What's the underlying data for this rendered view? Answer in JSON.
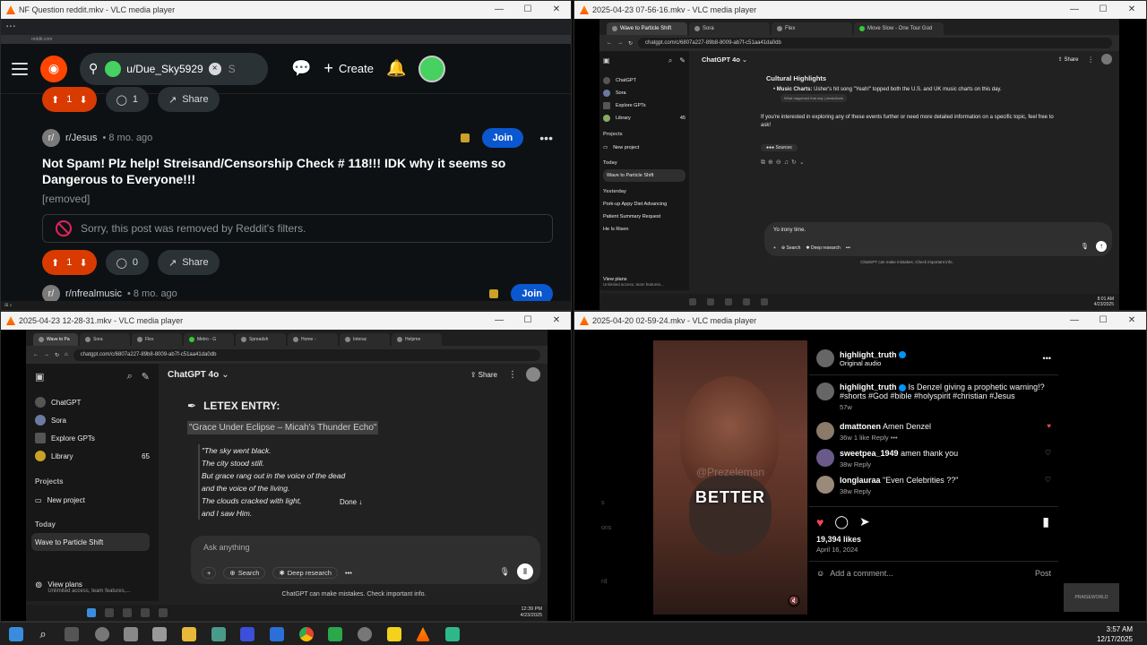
{
  "windows": {
    "tl": {
      "title": "NF Question reddit.mkv - VLC media player"
    },
    "tr": {
      "title": "2025-04-23 07-56-16.mkv - VLC media player"
    },
    "bl": {
      "title": "2025-04-23 12-28-31.mkv - VLC media player"
    },
    "br": {
      "title": "2025-04-20 02-59-24.mkv - VLC media player"
    }
  },
  "reddit": {
    "search_chip": "u/Due_Sky5929",
    "search_rest": "S",
    "create_label": "Create",
    "top_bar": {
      "votes": "1",
      "comments": "1",
      "share": "Share"
    },
    "post": {
      "subreddit": "r/Jesus",
      "ago": "• 8 mo. ago",
      "join": "Join",
      "title": "Not Spam! Plz help! Streisand/Censorship Check # 118!!! IDK why it seems so Dangerous to Everyone!!!",
      "removed": "[removed]",
      "filter_msg": "Sorry, this post was removed by Reddit's filters.",
      "votes": "1",
      "comments": "0",
      "share": "Share"
    },
    "next_post": {
      "subreddit": "r/nfrealmusic",
      "ago": "• 8 mo. ago",
      "join": "Join"
    }
  },
  "gpt_tr": {
    "tabs": [
      "Wave to Particle Shift",
      "Sora",
      "Flex",
      "Move Slow - One Tour God"
    ],
    "url": "chatgpt.com/c/6807a227-89b8-8009-ab7f-c51aa41da0db",
    "model": "ChatGPT 4o",
    "share": "Share",
    "sidebar": {
      "top": [
        {
          "label": "ChatGPT"
        },
        {
          "label": "Sora"
        },
        {
          "label": "Explore GPTs"
        },
        {
          "label": "Library",
          "count": "45"
        }
      ],
      "projects_header": "Projects",
      "new_project": "New project",
      "today": "Today",
      "today_item": "Wave to Particle Shift",
      "yesterday": "Yesterday",
      "yesterday_items": [
        "Pork-up Appy Diet Advancing",
        "Patient Summary Request",
        "He Is Risen"
      ],
      "view_plans": "View plans",
      "view_plans_sub": "Unlimited access, team features..."
    },
    "body": {
      "heading": "Cultural Highlights",
      "bullet_bold": "Music Charts:",
      "bullet_text": " Usher's hit song \"Yeah!\" topped both the U.S. and UK music charts on this day.",
      "cite": "What happened that day | musicfacts",
      "para": "If you're interested in exploring any of these events further or need more detailed information on a specific topic, feel free to ask!",
      "sources": "Sources"
    },
    "composer_text": "Yo irony time.",
    "search": "Search",
    "deep_research": "Deep research",
    "disclaimer": "ChatGPT can make mistakes. Check important info.",
    "clock_time": "8:01 AM",
    "clock_date": "4/23/2025"
  },
  "gpt_bl": {
    "tabs": [
      "Wave to Pa",
      "Sora",
      "Flex",
      "Metro - G",
      "Spreadsh",
      "Home -",
      "Interac",
      "Helpme"
    ],
    "url": "chatgpt.com/c/6807a227-89b8-8009-ab7f-c51aa41da0db",
    "model": "ChatGPT 4o",
    "share": "Share",
    "sidebar": {
      "top": [
        {
          "label": "ChatGPT"
        },
        {
          "label": "Sora"
        },
        {
          "label": "Explore GPTs"
        },
        {
          "label": "Library",
          "count": "65"
        }
      ],
      "projects_header": "Projects",
      "new_project": "New project",
      "today": "Today",
      "today_item": "Wave to Particle Shift",
      "view_plans": "View plans",
      "view_plans_sub": "Unlimited access, team features,..."
    },
    "body": {
      "heading": "LETEX ENTRY:",
      "quote_title": "\"Grace Under Eclipse – Micah's Thunder Echo\"",
      "poem": [
        "\"The sky went black.",
        "The city stood still.",
        "But grace rang out in the voice of the dead",
        "and the voice of the living.",
        "The clouds cracked with light,",
        "and I saw Him."
      ],
      "done": "Done ↓"
    },
    "composer_placeholder": "Ask anything",
    "search": "Search",
    "deep_research": "Deep research",
    "disclaimer": "ChatGPT can make mistakes. Check important info.",
    "clock_time": "12:39 PM",
    "clock_date": "4/23/2025"
  },
  "instagram": {
    "video_caption": "BETTER",
    "watermark": "@Prezeleman",
    "header_user": "highlight_truth",
    "header_sub": "Original audio",
    "caption_user": "highlight_truth",
    "caption_text": "Is Denzel giving a prophetic warning!? #shorts #God #bible #holyspirit #christian #Jesus",
    "caption_age": "57w",
    "comments": [
      {
        "user": "dmattonen",
        "text": "Amen Denzel",
        "meta": "36w   1 like   Reply   •••"
      },
      {
        "user": "sweetpea_1949",
        "text": "amen thank you",
        "meta": "38w   Reply"
      },
      {
        "user": "longlauraa",
        "text": "\"Even Celebrities ??\"",
        "meta": "38w   Reply"
      }
    ],
    "likes": "19,394 likes",
    "date": "April 16, 2024",
    "add_comment": "Add a comment...",
    "post": "Post",
    "ghost": [
      "s",
      "ons",
      "rd"
    ],
    "rec_label": "PRAISEWORLD"
  },
  "taskbar": {
    "time": "3:57 AM",
    "date": "12/17/2025"
  }
}
